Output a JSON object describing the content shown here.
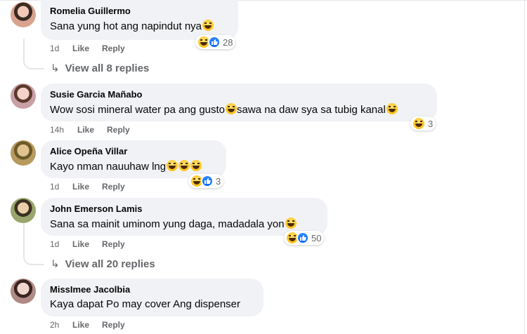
{
  "comments": [
    {
      "author": "Romelia Guillermo",
      "text": "Sana yung hot ang napindut nya",
      "time": "1d",
      "like_label": "Like",
      "reply_label": "Reply",
      "reaction_count": "28",
      "reactions": [
        "haha-icon",
        "like-icon"
      ],
      "avatar_color": "#d9a48f"
    },
    {
      "author": "Susie Garcia Mañabo",
      "text": "Wow sosi mineral water pa ang gusto",
      "text_after": "sawa na daw sya sa tubig kanal",
      "time": "14h",
      "like_label": "Like",
      "reply_label": "Reply",
      "reaction_count": "3",
      "reactions": [
        "haha-icon"
      ],
      "avatar_color": "#caa0a6"
    },
    {
      "author": "Alice Opeña Villar",
      "text": "Kayo nman nauuhaw lng",
      "time": "1d",
      "like_label": "Like",
      "reply_label": "Reply",
      "reaction_count": "3",
      "reactions": [
        "haha-icon",
        "like-icon"
      ],
      "avatar_color": "#b89a5e"
    },
    {
      "author": "John Emerson Lamis",
      "text": "Sana sa mainit uminom yung daga, madadala yon",
      "time": "1d",
      "like_label": "Like",
      "reply_label": "Reply",
      "reaction_count": "50",
      "reactions": [
        "haha-icon",
        "like-icon"
      ],
      "avatar_color": "#9aa56d"
    },
    {
      "author": "MissImee Jacolbia",
      "text": "Kaya dapat Po may cover Ang dispenser",
      "time": "2h",
      "like_label": "Like",
      "reply_label": "Reply",
      "avatar_color": "#b08b86"
    }
  ],
  "view_replies": [
    {
      "label": "View all 8 replies"
    },
    {
      "label": "View all 20 replies"
    }
  ],
  "colors": {
    "bubble": "#f0f2f5",
    "meta": "#65676b",
    "like_blue": "#0866ff",
    "haha_yellow": "#fcc419"
  }
}
